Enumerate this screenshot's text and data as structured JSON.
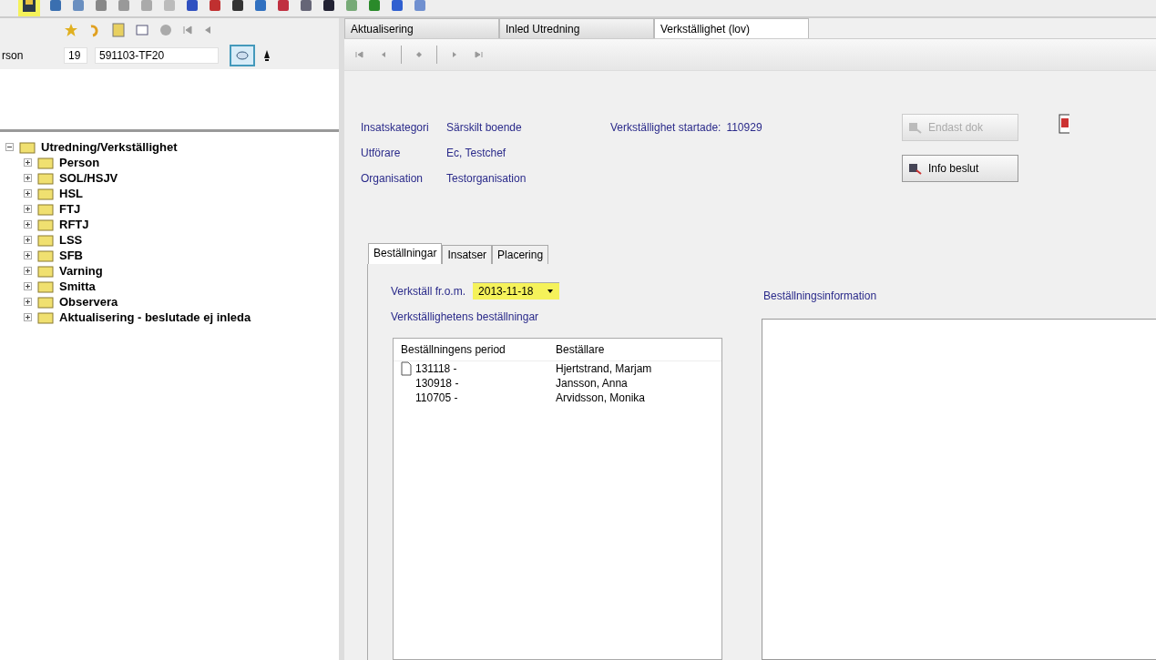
{
  "person": {
    "label": "rson",
    "century": "19",
    "id": "591103-TF20"
  },
  "tree": {
    "label": "Utredning/Verkställighet",
    "expanded": true,
    "children": [
      {
        "label": "Person",
        "expanded": false
      },
      {
        "label": "SOL/HSJV",
        "expanded": false
      },
      {
        "label": "HSL",
        "expanded": false
      },
      {
        "label": "FTJ",
        "expanded": false
      },
      {
        "label": "RFTJ",
        "expanded": false
      },
      {
        "label": "LSS",
        "expanded": false
      },
      {
        "label": "SFB",
        "expanded": false
      },
      {
        "label": "Varning",
        "expanded": false
      },
      {
        "label": "Smitta",
        "expanded": false
      },
      {
        "label": "Observera",
        "expanded": false
      },
      {
        "label": "Aktualisering - beslutade ej inleda",
        "expanded": false
      }
    ]
  },
  "tabs": [
    {
      "label": "Aktualisering",
      "selected": false
    },
    {
      "label": "Inled Utredning",
      "selected": false
    },
    {
      "label": "Verkställighet (lov)",
      "selected": true
    }
  ],
  "info": [
    {
      "label": "Insatskategori",
      "value": "Särskilt boende"
    },
    {
      "label": "Utförare",
      "value": "Ec, Testchef"
    },
    {
      "label": "Organisation",
      "value": "Testorganisation"
    }
  ],
  "started": {
    "label": "Verkställighet startade:",
    "value": "110929"
  },
  "buttons": [
    {
      "label": "Endast dok",
      "disabled": true
    },
    {
      "label": "Info beslut",
      "disabled": false
    }
  ],
  "inner_tabs": [
    {
      "label": "Beställningar",
      "selected": true
    },
    {
      "label": "Insatser",
      "selected": false
    },
    {
      "label": "Placering",
      "selected": false
    }
  ],
  "date_field": {
    "label": "Verkställ fr.o.m.",
    "value": "2013-11-18"
  },
  "orders_title": "Verkställighetens beställningar",
  "orders": {
    "columns": [
      "Beställningens period",
      "Beställare"
    ],
    "rows": [
      {
        "kind": "document",
        "period": "131118 -",
        "orderer": "Hjertstrand, Marjam"
      },
      {
        "kind": "plain",
        "period": "130918 -",
        "orderer": "Jansson, Anna"
      },
      {
        "kind": "plain",
        "period": "110705 -",
        "orderer": "Arvidsson, Monika"
      }
    ]
  },
  "info_title": "Beställningsinformation"
}
